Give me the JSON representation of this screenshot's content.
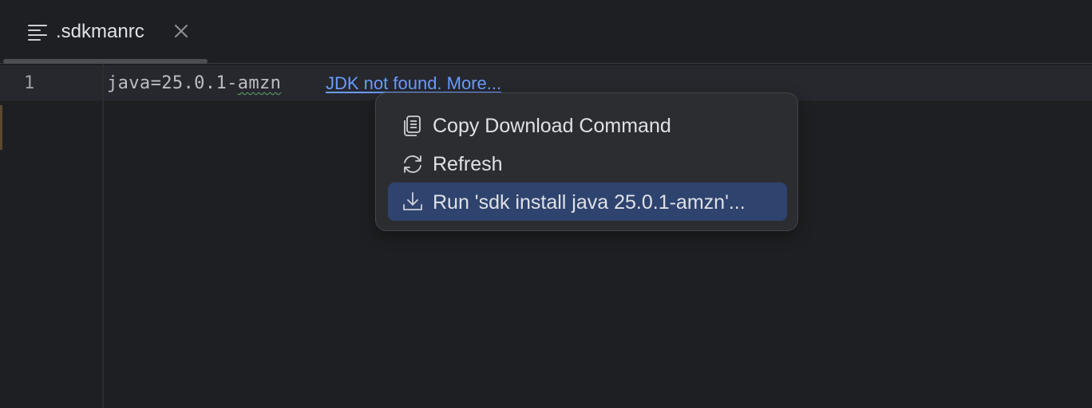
{
  "tab": {
    "label": ".sdkmanrc",
    "icon": "text-file-icon",
    "close_icon": "close-icon"
  },
  "editor": {
    "lines": [
      {
        "number": "1",
        "text_prefix": "java=25.0.1-",
        "text_flagged": "amzn"
      }
    ],
    "inlay_link": "JDK not found. More..."
  },
  "popup_menu": {
    "items": [
      {
        "label": "Copy Download Command",
        "icon": "copy-icon",
        "selected": false
      },
      {
        "label": "Refresh",
        "icon": "refresh-icon",
        "selected": false
      },
      {
        "label": "Run 'sdk install java 25.0.1-amzn'...",
        "icon": "download-icon",
        "selected": true
      }
    ]
  },
  "colors": {
    "background": "#1e1f22",
    "link": "#6b9bfa",
    "selection": "#2e436e",
    "popup_background": "#2b2d30"
  }
}
